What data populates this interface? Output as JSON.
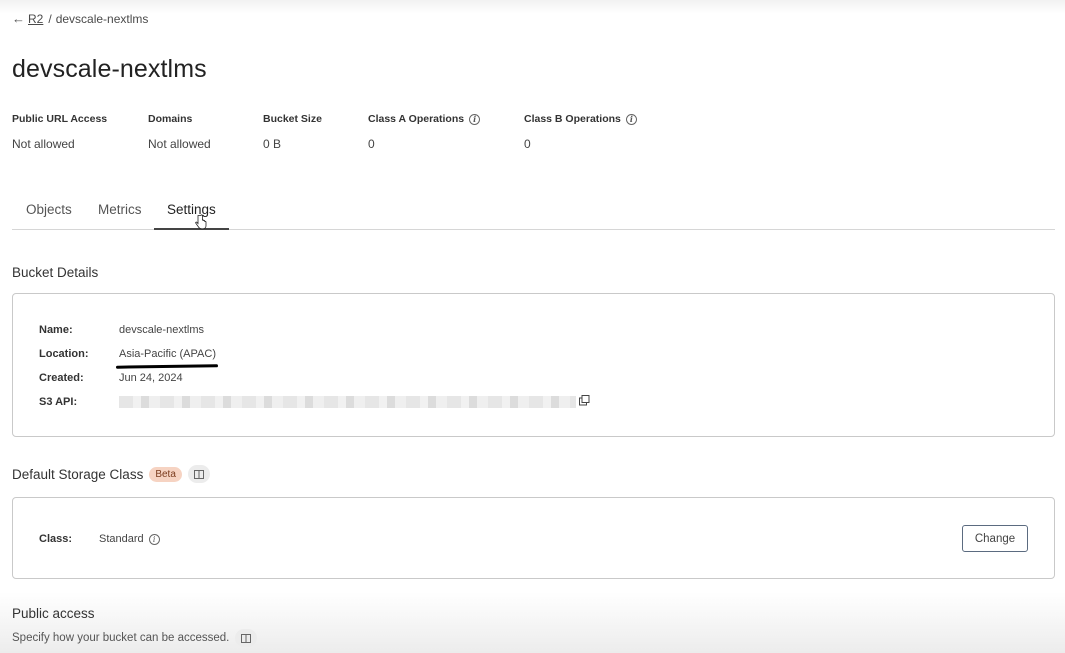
{
  "breadcrumb": {
    "parent": "R2",
    "separator": "/",
    "current": "devscale-nextlms"
  },
  "page_title": "devscale-nextlms",
  "stats": [
    {
      "label": "Public URL Access",
      "value": "Not allowed",
      "info": false
    },
    {
      "label": "Domains",
      "value": "Not allowed",
      "info": false
    },
    {
      "label": "Bucket Size",
      "value": "0 B",
      "info": false
    },
    {
      "label": "Class A Operations",
      "value": "0",
      "info": true
    },
    {
      "label": "Class B Operations",
      "value": "0",
      "info": true
    }
  ],
  "tabs": [
    {
      "label": "Objects",
      "active": false
    },
    {
      "label": "Metrics",
      "active": false
    },
    {
      "label": "Settings",
      "active": true
    }
  ],
  "bucket_details": {
    "title": "Bucket Details",
    "name_label": "Name:",
    "name_value": "devscale-nextlms",
    "location_label": "Location:",
    "location_value": "Asia-Pacific (APAC)",
    "created_label": "Created:",
    "created_value": "Jun 24, 2024",
    "s3api_label": "S3 API:"
  },
  "storage_class": {
    "title": "Default Storage Class",
    "badge": "Beta",
    "class_label": "Class:",
    "class_value": "Standard",
    "change_button": "Change"
  },
  "public_access": {
    "title": "Public access",
    "description": "Specify how your bucket can be accessed."
  },
  "icons": {
    "back": "arrow-left-icon",
    "info": "info-circle-icon",
    "copy": "copy-icon",
    "docs": "book-icon",
    "cursor": "hand-pointer-icon"
  },
  "colors": {
    "badge_bg": "#f6d3c2",
    "badge_text": "#7a3b1d",
    "button_border": "#5b6b80"
  }
}
